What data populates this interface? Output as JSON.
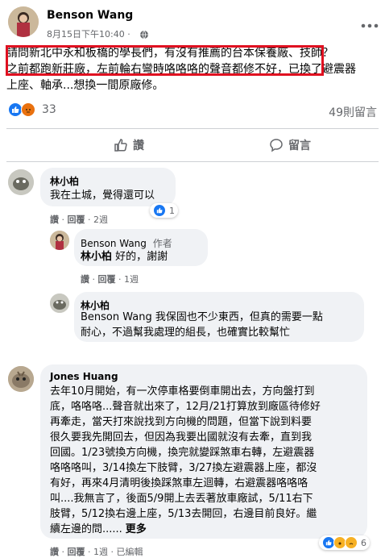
{
  "post": {
    "author": "Benson Wang",
    "timestamp": "8月15日下午10:40 ·",
    "line1": "請問新北中永和板橋的學長們，有沒有推薦的台本保養廠、技師？",
    "line2": "之前都跑新莊廠，左前輪右彎時咯咯咯的聲音都修不好，已換了避震器",
    "line3": "上座、軸承...想換一間原廠修。",
    "reaction_count": "33",
    "comment_count": "49則留言",
    "like_label": "讚",
    "comment_label": "留言"
  },
  "comments": [
    {
      "name": "林小柏",
      "text": "我在土城，覺得還可以",
      "like": "讚",
      "reply": "回覆",
      "time": "2週",
      "reactions": "1"
    },
    {
      "name": "Benson Wang",
      "badge": "作者",
      "mention": "林小柏",
      "text": " 好的，謝謝",
      "like": "讚",
      "reply": "回覆",
      "time": "1週"
    },
    {
      "name": "林小柏",
      "mention": "Benson Wang",
      "text_l1": " 我保固也不少東西，但真的需要一點",
      "text_l2": "耐心，不過幫我處理的組長，也確實比較幫忙"
    },
    {
      "name": "Jones Huang",
      "lines": [
        "去年10月開始，有一次停車格要倒車開出去，方向盤打到",
        "底，咯咯咯...聲音就出來了，12月/21打算放到廠區待修好",
        "再牽走，當天打來說找到方向機的問題，但當下說到料要",
        "很久要我先開回去，但因為我要出國就沒有去牽，直到我",
        "回國。1/23號換方向機，換完就變踩煞車右轉，左避震器",
        "咯咯咯叫，3/14換左下肢臂，3/27換左避震器上座，都沒",
        "有好，再來4月清明後換踩煞車左迴轉，右避震器咯咯咯",
        "叫....我無言了，後面5/9開上去丟著放車廠試，5/11右下",
        "肢臂，5/12換右邊上座，5/13去開回，右邊目前良好。繼"
      ],
      "last_line": "續左邊的問......",
      "more": "更多",
      "like": "讚",
      "reply": "回覆",
      "time": "1週",
      "edited": "已編輯",
      "reactions": "6"
    }
  ],
  "icons": {
    "like": "like-thumb-icon",
    "comment": "speech-bubble-icon",
    "more": "more-dots-icon",
    "globe": "globe-icon"
  },
  "colors": {
    "highlight": "#e01020",
    "like_blue": "#1877f2",
    "angry_orange": "#e9710f"
  }
}
